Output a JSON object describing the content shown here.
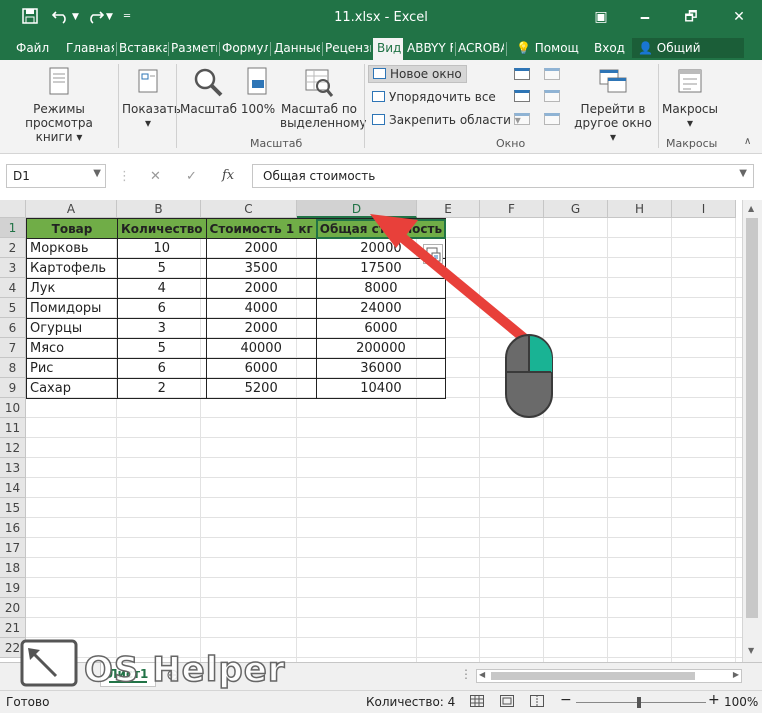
{
  "titlebar": {
    "title": "11.xlsx - Excel",
    "save_icon": "save-icon",
    "undo_icon": "undo-icon",
    "redo_icon": "redo-icon",
    "minimize": "🗕",
    "restore": "🗗",
    "close": "✕",
    "ribbon_display": "▣"
  },
  "tabs": [
    "Файл",
    "Главная",
    "Вставка",
    "Разметк",
    "Формул",
    "Данные",
    "Рецензи",
    "Вид",
    "ABBYY F",
    "ACROBA"
  ],
  "tab_active": "Вид",
  "tell_me": "Помощ",
  "signin": "Вход",
  "share": "Общий доступ",
  "ribbon": {
    "views_label_1": "Режимы просмотра",
    "views_label_2": "книги",
    "show_label": "Показать",
    "zoom_label": "Масштаб",
    "zoom100_label": "100%",
    "zoom_sel_1": "Масштаб по",
    "zoom_sel_2": "выделенному",
    "group_zoom": "Масштаб",
    "new_window": "Новое окно",
    "arrange_all": "Упорядочить все",
    "freeze_panes": "Закрепить области",
    "switch_1": "Перейти в",
    "switch_2": "другое окно",
    "group_window": "Окно",
    "macros_label": "Макросы",
    "group_macros": "Макросы"
  },
  "formula_bar": {
    "name_box": "D1",
    "cancel": "✕",
    "enter": "✓",
    "fx": "fx",
    "content": "Общая стоимость"
  },
  "columns": [
    "A",
    "B",
    "C",
    "D",
    "E",
    "F",
    "G",
    "H",
    "I"
  ],
  "rows": [
    "1",
    "2",
    "3",
    "4",
    "5",
    "6",
    "7",
    "8",
    "9",
    "10",
    "11",
    "12",
    "13",
    "14",
    "15",
    "16",
    "17",
    "18",
    "19",
    "20",
    "21",
    "22"
  ],
  "table": {
    "headers": [
      "Товар",
      "Количество",
      "Стоимость 1 кг",
      "Общая стоимость"
    ],
    "data": [
      [
        "Морковь",
        "10",
        "2000",
        "20000"
      ],
      [
        "Картофель",
        "5",
        "3500",
        "17500"
      ],
      [
        "Лук",
        "4",
        "2000",
        "8000"
      ],
      [
        "Помидоры",
        "6",
        "4000",
        "24000"
      ],
      [
        "Огурцы",
        "3",
        "2000",
        "6000"
      ],
      [
        "Мясо",
        "5",
        "40000",
        "200000"
      ],
      [
        "Рис",
        "6",
        "6000",
        "36000"
      ],
      [
        "Сахар",
        "2",
        "5200",
        "10400"
      ]
    ]
  },
  "sheet_tab": "Лист1",
  "status": {
    "ready": "Готово",
    "count": "Количество: 4",
    "zoom": "100%"
  },
  "watermark": "OS Helper",
  "colors": {
    "excel_green": "#217346",
    "header_fill": "#70ad47",
    "arrow": "#e8403a",
    "mouse_accent": "#19b394"
  }
}
